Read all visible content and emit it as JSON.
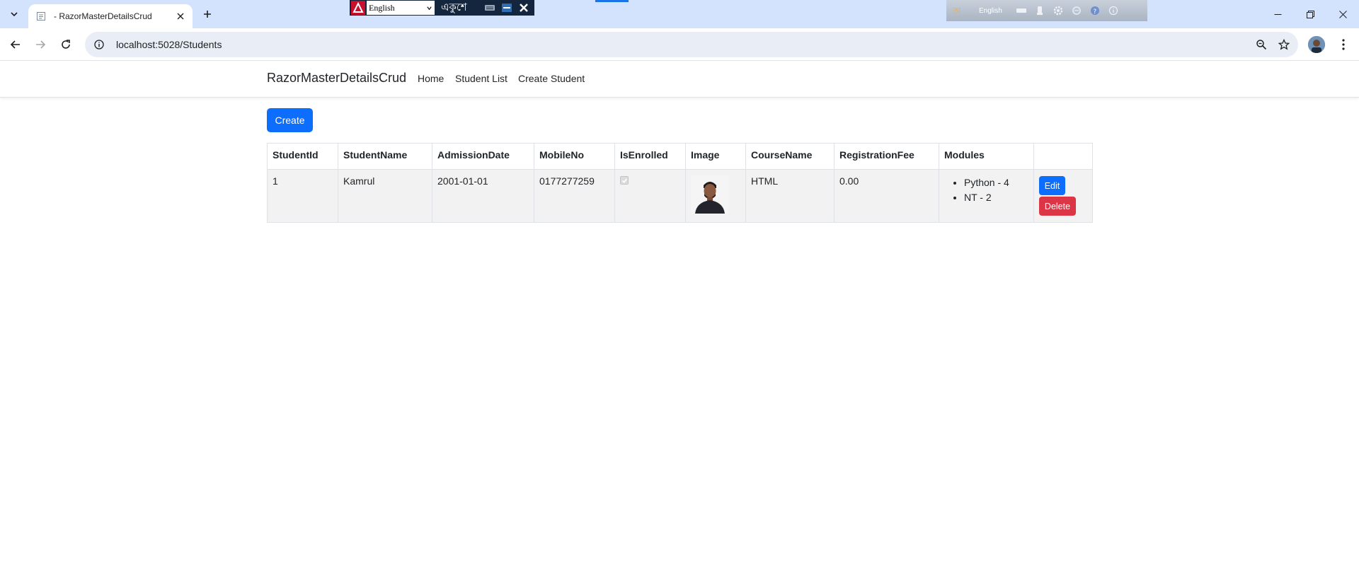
{
  "browser": {
    "tab": {
      "title": "- RazorMasterDetailsCrud"
    },
    "url": "localhost:5028/Students",
    "ime_toolbar": {
      "language_option": "English",
      "bengali_label": "একুশে"
    },
    "language_bar": {
      "language": "English"
    }
  },
  "app": {
    "brand": "RazorMasterDetailsCrud",
    "nav": [
      "Home",
      "Student List",
      "Create Student"
    ],
    "create_label": "Create"
  },
  "table": {
    "headers": [
      "StudentId",
      "StudentName",
      "AdmissionDate",
      "MobileNo",
      "IsEnrolled",
      "Image",
      "CourseName",
      "RegistrationFee",
      "Modules",
      ""
    ],
    "rows": [
      {
        "student_id": "1",
        "student_name": "Kamrul",
        "admission_date": "2001-01-01",
        "mobile_no": "0177277259",
        "is_enrolled": true,
        "course_name": "HTML",
        "registration_fee": "0.00",
        "modules": [
          "Python - 4",
          "NT - 2"
        ],
        "edit_label": "Edit",
        "delete_label": "Delete"
      }
    ]
  },
  "colors": {
    "primary": "#0d6efd",
    "danger": "#dc3545",
    "tabstrip": "#d3e3fd",
    "omnibox": "#e9eef6",
    "row_background": "#f2f2f2"
  }
}
